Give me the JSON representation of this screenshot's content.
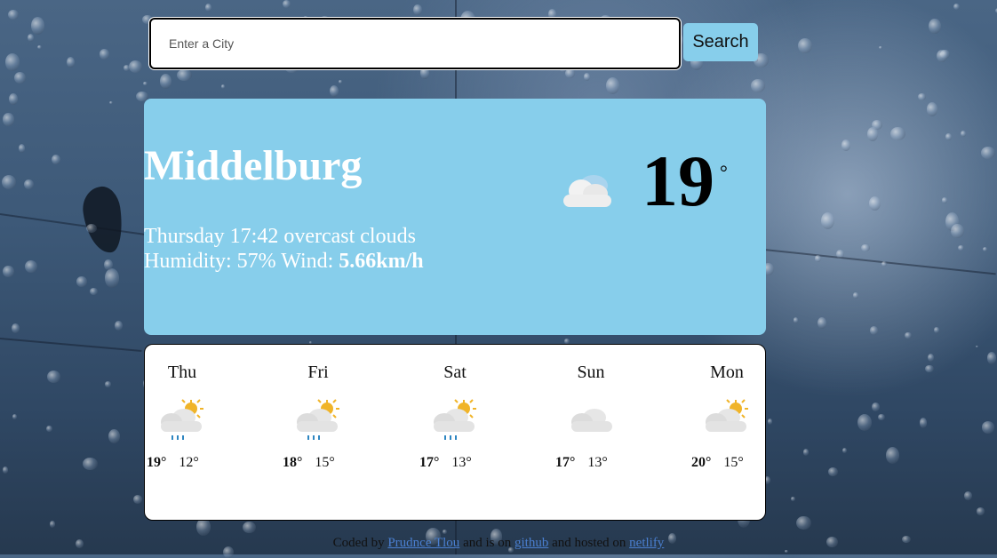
{
  "search": {
    "placeholder": "Enter a City",
    "value": "",
    "button_label": "Search"
  },
  "current": {
    "city": "Middelburg",
    "day_time": "Thursday 17:42",
    "description": "overcast clouds",
    "humidity_label": "Humidity:",
    "humidity": "57%",
    "wind_label": "Wind:",
    "wind": "5.66km/h",
    "temperature": "19",
    "degree_symbol": "°",
    "icon": "cloud-icon"
  },
  "forecast": [
    {
      "day": "Thu",
      "high": "19°",
      "low": "12°",
      "icon": "partly-cloudy-rain-icon"
    },
    {
      "day": "Fri",
      "high": "18°",
      "low": "15°",
      "icon": "partly-cloudy-rain-icon"
    },
    {
      "day": "Sat",
      "high": "17°",
      "low": "13°",
      "icon": "partly-cloudy-rain-icon"
    },
    {
      "day": "Sun",
      "high": "17°",
      "low": "13°",
      "icon": "cloud-icon"
    },
    {
      "day": "Mon",
      "high": "20°",
      "low": "15°",
      "icon": "partly-cloudy-icon"
    }
  ],
  "footer": {
    "prefix": "Coded by",
    "author_link": "Prudnce Tlou",
    "middle": "and is on",
    "github_link": "github",
    "hosted": "and hosted on",
    "netlify_link": "netlify"
  },
  "colors": {
    "card": "#87ceeb",
    "button": "#87ceeb",
    "link": "#4a7fd0"
  }
}
